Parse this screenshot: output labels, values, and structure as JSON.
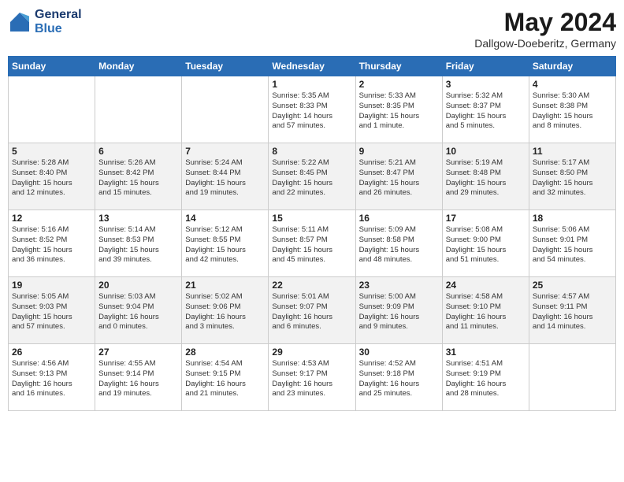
{
  "header": {
    "logo_line1": "General",
    "logo_line2": "Blue",
    "month_title": "May 2024",
    "location": "Dallgow-Doeberitz, Germany"
  },
  "days_of_week": [
    "Sunday",
    "Monday",
    "Tuesday",
    "Wednesday",
    "Thursday",
    "Friday",
    "Saturday"
  ],
  "weeks": [
    [
      {
        "day": "",
        "content": ""
      },
      {
        "day": "",
        "content": ""
      },
      {
        "day": "",
        "content": ""
      },
      {
        "day": "1",
        "content": "Sunrise: 5:35 AM\nSunset: 8:33 PM\nDaylight: 14 hours\nand 57 minutes."
      },
      {
        "day": "2",
        "content": "Sunrise: 5:33 AM\nSunset: 8:35 PM\nDaylight: 15 hours\nand 1 minute."
      },
      {
        "day": "3",
        "content": "Sunrise: 5:32 AM\nSunset: 8:37 PM\nDaylight: 15 hours\nand 5 minutes."
      },
      {
        "day": "4",
        "content": "Sunrise: 5:30 AM\nSunset: 8:38 PM\nDaylight: 15 hours\nand 8 minutes."
      }
    ],
    [
      {
        "day": "5",
        "content": "Sunrise: 5:28 AM\nSunset: 8:40 PM\nDaylight: 15 hours\nand 12 minutes."
      },
      {
        "day": "6",
        "content": "Sunrise: 5:26 AM\nSunset: 8:42 PM\nDaylight: 15 hours\nand 15 minutes."
      },
      {
        "day": "7",
        "content": "Sunrise: 5:24 AM\nSunset: 8:44 PM\nDaylight: 15 hours\nand 19 minutes."
      },
      {
        "day": "8",
        "content": "Sunrise: 5:22 AM\nSunset: 8:45 PM\nDaylight: 15 hours\nand 22 minutes."
      },
      {
        "day": "9",
        "content": "Sunrise: 5:21 AM\nSunset: 8:47 PM\nDaylight: 15 hours\nand 26 minutes."
      },
      {
        "day": "10",
        "content": "Sunrise: 5:19 AM\nSunset: 8:48 PM\nDaylight: 15 hours\nand 29 minutes."
      },
      {
        "day": "11",
        "content": "Sunrise: 5:17 AM\nSunset: 8:50 PM\nDaylight: 15 hours\nand 32 minutes."
      }
    ],
    [
      {
        "day": "12",
        "content": "Sunrise: 5:16 AM\nSunset: 8:52 PM\nDaylight: 15 hours\nand 36 minutes."
      },
      {
        "day": "13",
        "content": "Sunrise: 5:14 AM\nSunset: 8:53 PM\nDaylight: 15 hours\nand 39 minutes."
      },
      {
        "day": "14",
        "content": "Sunrise: 5:12 AM\nSunset: 8:55 PM\nDaylight: 15 hours\nand 42 minutes."
      },
      {
        "day": "15",
        "content": "Sunrise: 5:11 AM\nSunset: 8:57 PM\nDaylight: 15 hours\nand 45 minutes."
      },
      {
        "day": "16",
        "content": "Sunrise: 5:09 AM\nSunset: 8:58 PM\nDaylight: 15 hours\nand 48 minutes."
      },
      {
        "day": "17",
        "content": "Sunrise: 5:08 AM\nSunset: 9:00 PM\nDaylight: 15 hours\nand 51 minutes."
      },
      {
        "day": "18",
        "content": "Sunrise: 5:06 AM\nSunset: 9:01 PM\nDaylight: 15 hours\nand 54 minutes."
      }
    ],
    [
      {
        "day": "19",
        "content": "Sunrise: 5:05 AM\nSunset: 9:03 PM\nDaylight: 15 hours\nand 57 minutes."
      },
      {
        "day": "20",
        "content": "Sunrise: 5:03 AM\nSunset: 9:04 PM\nDaylight: 16 hours\nand 0 minutes."
      },
      {
        "day": "21",
        "content": "Sunrise: 5:02 AM\nSunset: 9:06 PM\nDaylight: 16 hours\nand 3 minutes."
      },
      {
        "day": "22",
        "content": "Sunrise: 5:01 AM\nSunset: 9:07 PM\nDaylight: 16 hours\nand 6 minutes."
      },
      {
        "day": "23",
        "content": "Sunrise: 5:00 AM\nSunset: 9:09 PM\nDaylight: 16 hours\nand 9 minutes."
      },
      {
        "day": "24",
        "content": "Sunrise: 4:58 AM\nSunset: 9:10 PM\nDaylight: 16 hours\nand 11 minutes."
      },
      {
        "day": "25",
        "content": "Sunrise: 4:57 AM\nSunset: 9:11 PM\nDaylight: 16 hours\nand 14 minutes."
      }
    ],
    [
      {
        "day": "26",
        "content": "Sunrise: 4:56 AM\nSunset: 9:13 PM\nDaylight: 16 hours\nand 16 minutes."
      },
      {
        "day": "27",
        "content": "Sunrise: 4:55 AM\nSunset: 9:14 PM\nDaylight: 16 hours\nand 19 minutes."
      },
      {
        "day": "28",
        "content": "Sunrise: 4:54 AM\nSunset: 9:15 PM\nDaylight: 16 hours\nand 21 minutes."
      },
      {
        "day": "29",
        "content": "Sunrise: 4:53 AM\nSunset: 9:17 PM\nDaylight: 16 hours\nand 23 minutes."
      },
      {
        "day": "30",
        "content": "Sunrise: 4:52 AM\nSunset: 9:18 PM\nDaylight: 16 hours\nand 25 minutes."
      },
      {
        "day": "31",
        "content": "Sunrise: 4:51 AM\nSunset: 9:19 PM\nDaylight: 16 hours\nand 28 minutes."
      },
      {
        "day": "",
        "content": ""
      }
    ]
  ]
}
